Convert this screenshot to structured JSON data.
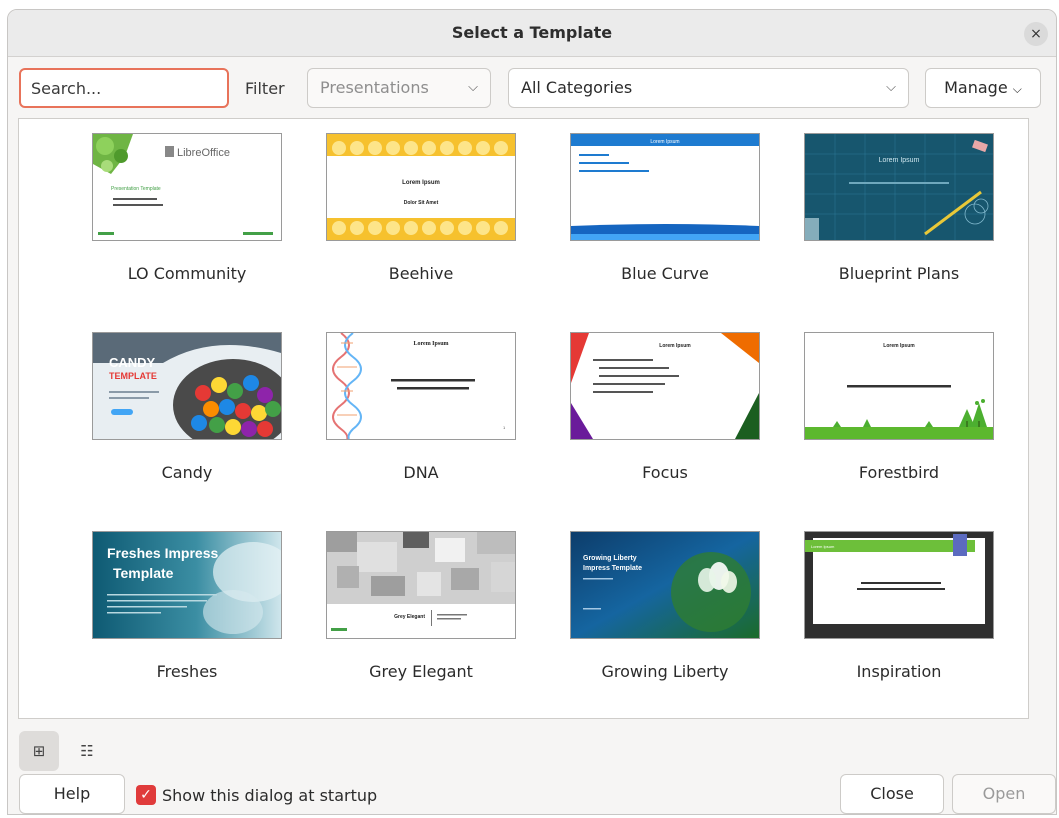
{
  "dialog": {
    "title": "Select a Template",
    "close_glyph": "×"
  },
  "toolbar": {
    "search_placeholder": "Search...",
    "filter_label": "Filter",
    "filter_value": "Presentations",
    "category_value": "All Categories",
    "manage_label": "Manage",
    "chevron": "⌵"
  },
  "templates": [
    {
      "name": "LO Community",
      "title_text": "Presentation Template",
      "brand": "LibreOffice"
    },
    {
      "name": "Beehive",
      "title_text": "Lorem Ipsum",
      "subtitle_text": "Dolor Sit Amet"
    },
    {
      "name": "Blue Curve",
      "title_text": "Lorem Ipsum"
    },
    {
      "name": "Blueprint Plans",
      "title_text": "Lorem Ipsum"
    },
    {
      "name": "Candy",
      "title_text": "CANDY",
      "subtitle_text": "TEMPLATE"
    },
    {
      "name": "DNA",
      "title_text": "Lorem Ipsum",
      "subtitle_text": "Lorem ipsum dolor sit amet, consectetur adipiscing elit."
    },
    {
      "name": "Focus",
      "title_text": "Lorem Ipsum"
    },
    {
      "name": "Forestbird",
      "title_text": "Lorem Ipsum"
    },
    {
      "name": "Freshes",
      "title_text": "Freshes Impress",
      "subtitle_text": "Template"
    },
    {
      "name": "Grey Elegant",
      "title_text": "Grey Elegant"
    },
    {
      "name": "Growing Liberty",
      "title_text": "Growing Liberty",
      "subtitle_text": "Impress Template"
    },
    {
      "name": "Inspiration",
      "title_text": "Lorem Ipsum",
      "subtitle_text": "Lorem ipsum dolor sit amet consectetur adipiscing elit"
    }
  ],
  "view": {
    "thumbnail_glyph": "⊞",
    "list_glyph": "☷"
  },
  "footer": {
    "help_label": "Help",
    "startup_checkbox_label": "Show this dialog at startup",
    "startup_checked": true,
    "check_glyph": "✓",
    "close_label": "Close",
    "open_label": "Open"
  },
  "colors": {
    "accent": "#e03b3b",
    "search_focus": "#e8735a"
  }
}
